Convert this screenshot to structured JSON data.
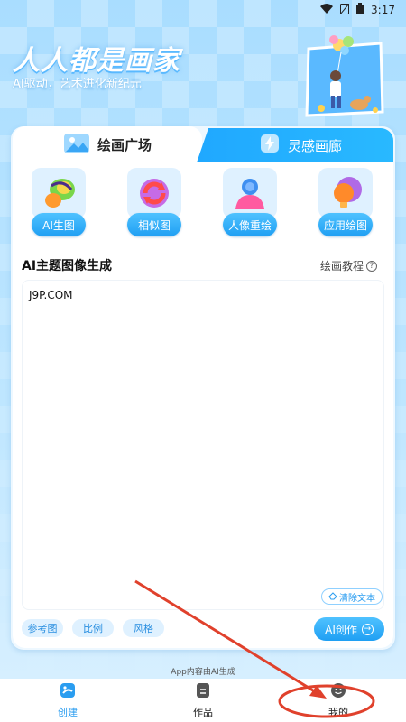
{
  "status_bar": {
    "time": "3:17"
  },
  "hero": {
    "title": "人人都是画家",
    "subtitle": "AI驱动，艺术进化新纪元"
  },
  "tabs": [
    {
      "label": "绘画广场",
      "icon": "landscape-icon",
      "active": true
    },
    {
      "label": "灵感画廊",
      "icon": "lightning-icon",
      "active": false
    }
  ],
  "tools": [
    {
      "label": "AI生图",
      "icon": "leaf-icon"
    },
    {
      "label": "相似图",
      "icon": "refresh-icon"
    },
    {
      "label": "人像重绘",
      "icon": "person-icon"
    },
    {
      "label": "应用绘图",
      "icon": "bulb-icon"
    }
  ],
  "section": {
    "title": "AI主题图像生成",
    "tutorial_label": "绘画教程",
    "tutorial_icon": "?"
  },
  "prompt": {
    "value": "J9P.COM"
  },
  "clear_button": {
    "label": "清除文本"
  },
  "options": [
    "参考图",
    "比例",
    "风格"
  ],
  "create_button": {
    "label": "AI创作"
  },
  "footnote": "App内容由AI生成",
  "bottom_nav": [
    {
      "label": "创建",
      "icon": "create-icon",
      "active": true
    },
    {
      "label": "作品",
      "icon": "works-icon",
      "active": false
    },
    {
      "label": "我的",
      "icon": "profile-icon",
      "active": false
    }
  ],
  "colors": {
    "accent": "#1f9ff3",
    "annotation": "#e0412c"
  }
}
